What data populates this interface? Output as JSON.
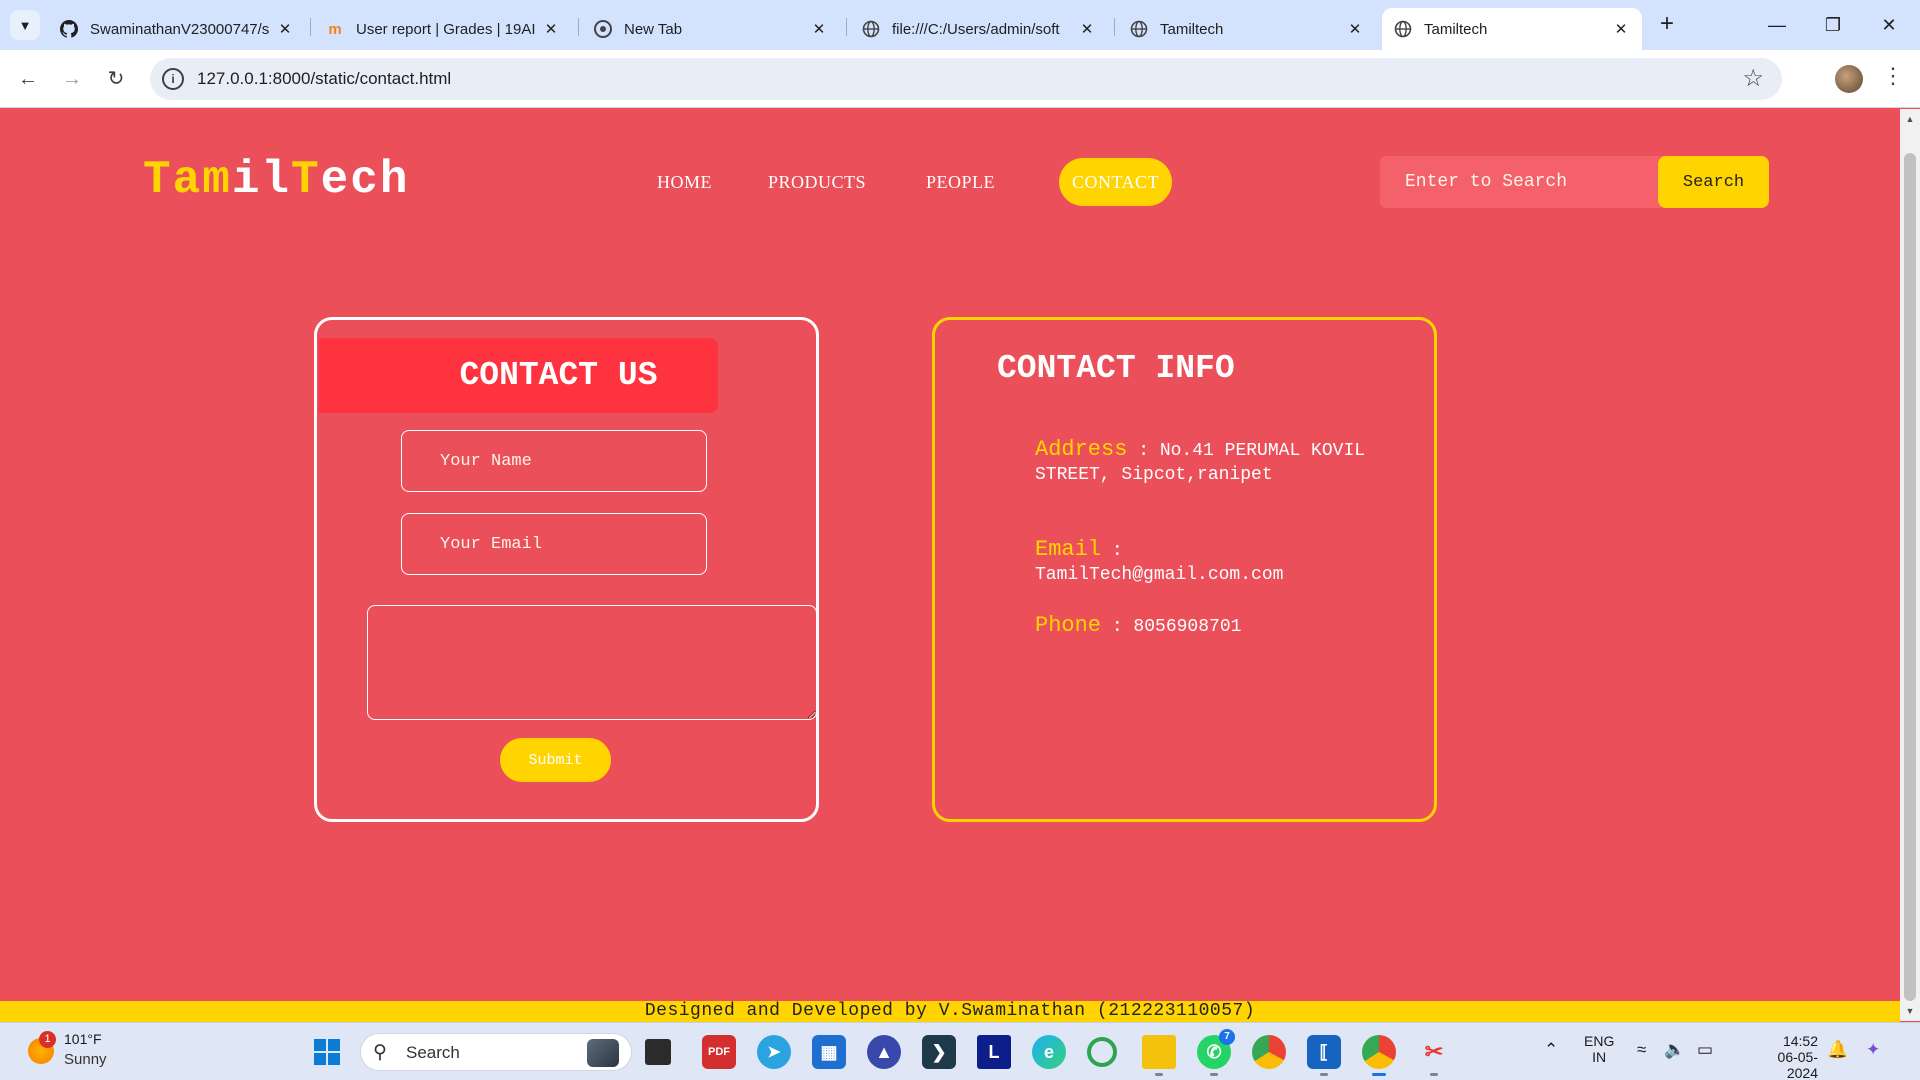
{
  "browser": {
    "tabs": [
      {
        "title": "SwaminathanV23000747/s",
        "icon": "github-icon"
      },
      {
        "title": "User report | Grades | 19AI",
        "icon": "moodle-icon"
      },
      {
        "title": "New Tab",
        "icon": "chrome-icon"
      },
      {
        "title": "file:///C:/Users/admin/soft",
        "icon": "globe-icon"
      },
      {
        "title": "Tamiltech",
        "icon": "globe-icon"
      },
      {
        "title": "Tamiltech",
        "icon": "globe-icon",
        "active": true
      }
    ],
    "url": "127.0.0.1:8000/static/contact.html"
  },
  "site": {
    "logo": {
      "part1": "Tam",
      "part2": "il",
      "part3": "T",
      "part4": "ech"
    },
    "nav": [
      "HOME",
      "PRODUCTS",
      "PEOPLE",
      "CONTACT"
    ],
    "active_nav": "CONTACT",
    "search": {
      "placeholder": "Enter to Search",
      "button": "Search"
    },
    "contact_form": {
      "title": "CONTACT US",
      "name_placeholder": "Your Name",
      "email_placeholder": "Your Email",
      "submit": "Submit"
    },
    "contact_info": {
      "title": "CONTACT INFO",
      "address_label": "Address",
      "address_value": " : No.41 PERUMAL KOVIL STREET, Sipcot,ranipet",
      "email_label": "Email",
      "email_value": " : TamilTech@gmail.com.com",
      "phone_label": "Phone",
      "phone_value": " : 8056908701"
    },
    "footer": "Designed and Developed by V.Swaminathan (212223110057)"
  },
  "taskbar": {
    "weather": {
      "temp": "101°F",
      "condition": "Sunny",
      "badge": "1"
    },
    "search_label": "Search",
    "whatsapp_badge": "7",
    "lang_line1": "ENG",
    "lang_line2": "IN",
    "time": "14:52",
    "date": "06-05-2024"
  },
  "colors": {
    "page_bg": "#eb505a",
    "accent": "#ffd400",
    "header_red": "#ff3340"
  }
}
